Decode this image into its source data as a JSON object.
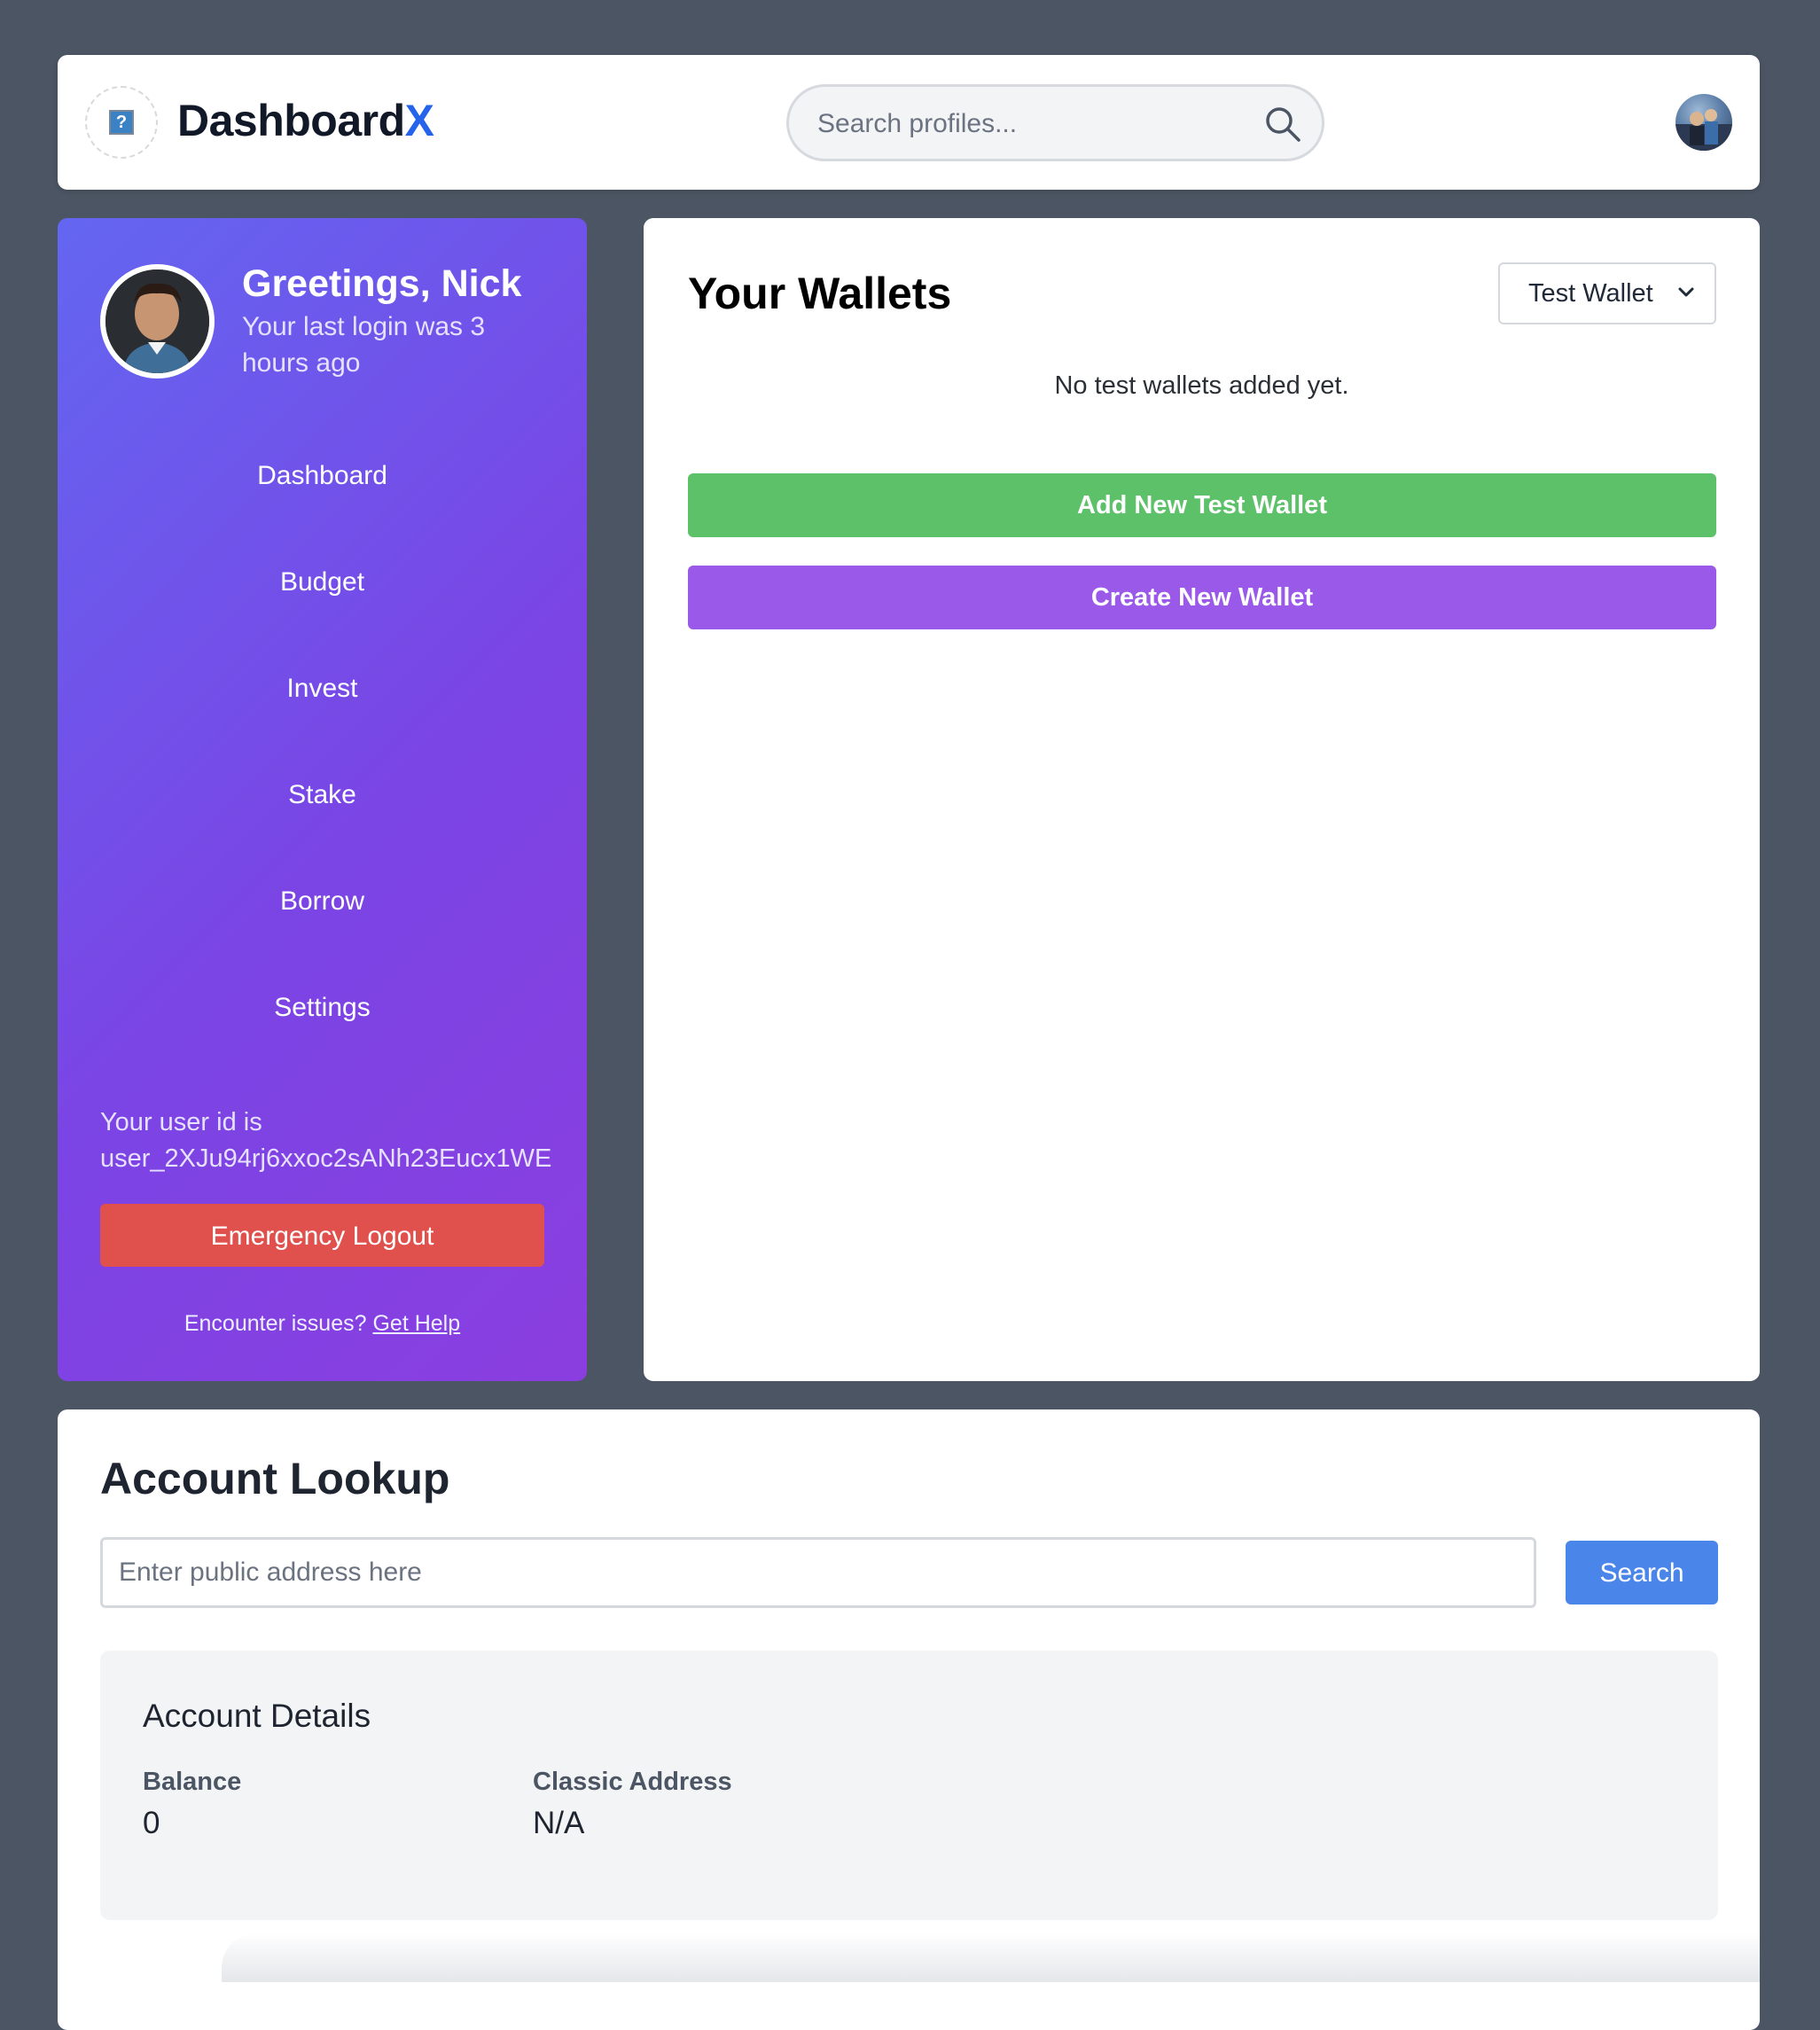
{
  "header": {
    "brand_main": "Dashboard",
    "brand_accent": "X",
    "logo_glyph": "?",
    "search_placeholder": "Search profiles...",
    "accent_color": "#2563eb"
  },
  "sidebar": {
    "greeting": "Greetings, Nick",
    "last_login": "Your last login was 3 hours ago",
    "nav": [
      {
        "label": "Dashboard"
      },
      {
        "label": "Budget"
      },
      {
        "label": "Invest"
      },
      {
        "label": "Stake"
      },
      {
        "label": "Borrow"
      },
      {
        "label": "Settings"
      }
    ],
    "user_id_label": "Your user id is",
    "user_id": "user_2XJu94rj6xxoc2sANh23Eucx1WE",
    "logout_label": "Emergency Logout",
    "help_prefix": "Encounter issues?",
    "help_link": "Get Help",
    "gradient_colors": [
      "#6366f1",
      "#8b3ee0"
    ]
  },
  "wallets": {
    "title": "Your Wallets",
    "selected_type": "Test Wallet",
    "empty_message": "No test wallets added yet.",
    "add_test_label": "Add New Test Wallet",
    "create_label": "Create New Wallet"
  },
  "lookup": {
    "title": "Account Lookup",
    "input_placeholder": "Enter public address here",
    "search_label": "Search",
    "details": {
      "title": "Account Details",
      "balance_label": "Balance",
      "balance_value": "0",
      "classic_label": "Classic Address",
      "classic_value": "N/A"
    }
  }
}
